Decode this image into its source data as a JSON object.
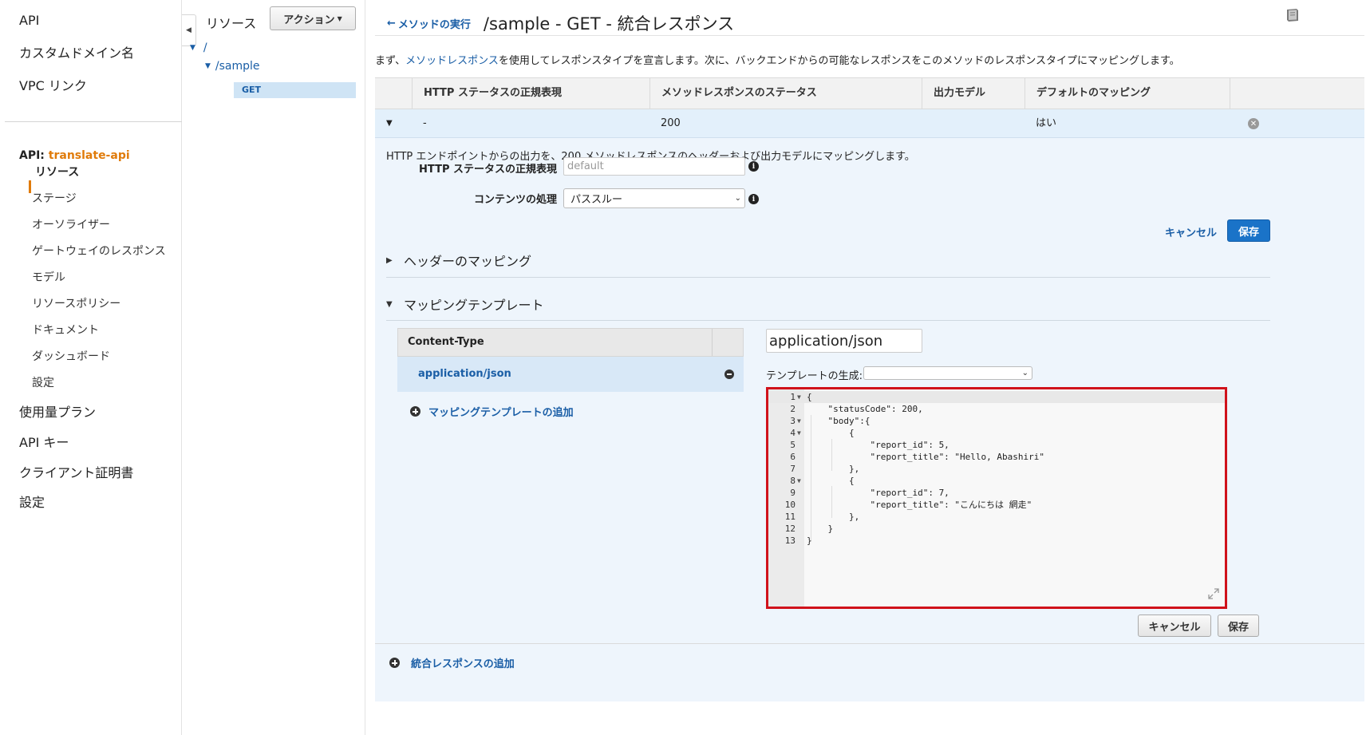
{
  "nav": {
    "top_items": [
      "API",
      "カスタムドメイン名",
      "VPC リンク"
    ],
    "api_prefix": "API: ",
    "api_name": "translate-api",
    "sub_items": [
      "リソース",
      "ステージ",
      "オーソライザー",
      "ゲートウェイのレスポンス",
      "モデル",
      "リソースポリシー",
      "ドキュメント",
      "ダッシュボード",
      "設定"
    ],
    "bottom_items": [
      "使用量プラン",
      "API キー",
      "クライアント証明書",
      "設定"
    ]
  },
  "resources": {
    "title": "リソース",
    "action_label": "アクション",
    "tree": [
      "/",
      "/sample",
      "GET"
    ]
  },
  "header": {
    "back_link": "メソッドの実行",
    "title": "/sample - GET - 統合レスポンス"
  },
  "intro": {
    "part1": "まず、",
    "link": "メソッドレスポンス",
    "part2": "を使用してレスポンスタイプを宣言します。次に、バックエンドからの可能なレスポンスをこのメソッドのレスポンスタイプにマッピングします。"
  },
  "table": {
    "headers": [
      "HTTP ステータスの正規表現",
      "メソッドレスポンスのステータス",
      "出力モデル",
      "デフォルトのマッピング"
    ],
    "row": {
      "regex": "-",
      "status": "200",
      "model": "",
      "default": "はい"
    }
  },
  "detail": {
    "description": "HTTP エンドポイントからの出力を、200 メソッドレスポンスのヘッダーおよび出力モデルにマッピングします。",
    "regex_label": "HTTP ステータスの正規表現",
    "regex_placeholder": "default",
    "content_label": "コンテンツの処理",
    "content_value": "パススルー",
    "cancel_label": "キャンセル",
    "save_label": "保存"
  },
  "sections": {
    "header_mapping": "ヘッダーのマッピング",
    "mapping_template": "マッピングテンプレート"
  },
  "content_type": {
    "header": "Content-Type",
    "rows": [
      "application/json"
    ],
    "add_label": "マッピングテンプレートの追加",
    "selected_value": "application/json",
    "generate_label": "テンプレートの生成:",
    "generate_value": ""
  },
  "editor": {
    "lines": [
      "{",
      "    \"statusCode\": 200,",
      "    \"body\":{",
      "        {",
      "            \"report_id\": 5,",
      "            \"report_title\": \"Hello, Abashiri\"",
      "        },",
      "        {",
      "            \"report_id\": 7,",
      "            \"report_title\": \"こんにちは 網走\"",
      "        },",
      "    }",
      "}"
    ],
    "cancel_label": "キャンセル",
    "save_label": "保存"
  },
  "footer": {
    "add_integration_response": "統合レスポンスの追加"
  },
  "colors": {
    "accent": "#e07b0a",
    "link": "#1a5ea6",
    "primary": "#1a73c8",
    "highlight_border": "#d0121b"
  }
}
